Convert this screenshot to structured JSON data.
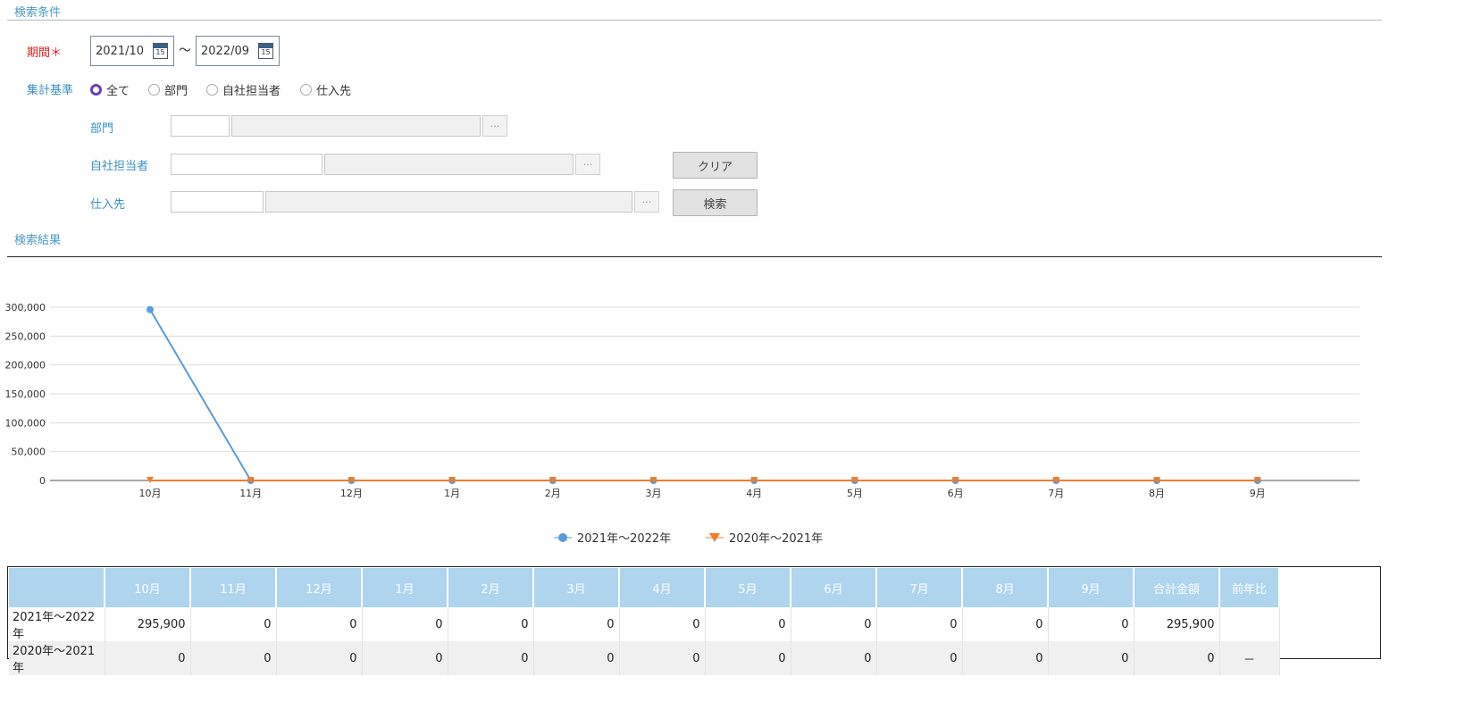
{
  "search_conditions": {
    "section_title": "検索条件",
    "period_label": "期間＊",
    "period_from": "2021/10",
    "period_to": "2022/09",
    "period_separator": "〜",
    "calendar_day": "15",
    "aggregation_label": "集計基準",
    "aggregation_options": [
      {
        "label": "全て",
        "selected": true
      },
      {
        "label": "部門",
        "selected": false
      },
      {
        "label": "自社担当者",
        "selected": false
      },
      {
        "label": "仕入先",
        "selected": false
      }
    ],
    "department_label": "部門",
    "staff_label": "自社担当者",
    "supplier_label": "仕入先",
    "lookup_label": "···",
    "clear_label": "クリア",
    "search_label": "検索"
  },
  "results": {
    "section_title": "検索結果"
  },
  "chart_data": {
    "type": "line",
    "categories": [
      "10月",
      "11月",
      "12月",
      "1月",
      "2月",
      "3月",
      "4月",
      "5月",
      "6月",
      "7月",
      "8月",
      "9月"
    ],
    "y_ticks": [
      "300,000",
      "250,000",
      "200,000",
      "150,000",
      "100,000",
      "50,000",
      "0"
    ],
    "ylim": [
      0,
      300000
    ],
    "grid": true,
    "legend_position": "bottom",
    "series": [
      {
        "name": "2021年〜2022年",
        "color": "#5b9bd5",
        "marker": "circle",
        "values": [
          295900,
          0,
          0,
          0,
          0,
          0,
          0,
          0,
          0,
          0,
          0,
          0
        ]
      },
      {
        "name": "2020年〜2021年",
        "color": "#ed7d31",
        "marker": "triangle-down",
        "values": [
          0,
          0,
          0,
          0,
          0,
          0,
          0,
          0,
          0,
          0,
          0,
          0
        ]
      }
    ]
  },
  "table": {
    "headers": [
      "",
      "10月",
      "11月",
      "12月",
      "1月",
      "2月",
      "3月",
      "4月",
      "5月",
      "6月",
      "7月",
      "8月",
      "9月",
      "合計金額",
      "前年比"
    ],
    "rows": [
      [
        "2021年〜2022年",
        "295,900",
        "0",
        "0",
        "0",
        "0",
        "0",
        "0",
        "0",
        "0",
        "0",
        "0",
        "0",
        "295,900",
        ""
      ],
      [
        "2020年〜2021年",
        "0",
        "0",
        "0",
        "0",
        "0",
        "0",
        "0",
        "0",
        "0",
        "0",
        "0",
        "0",
        "0",
        "－"
      ]
    ]
  }
}
